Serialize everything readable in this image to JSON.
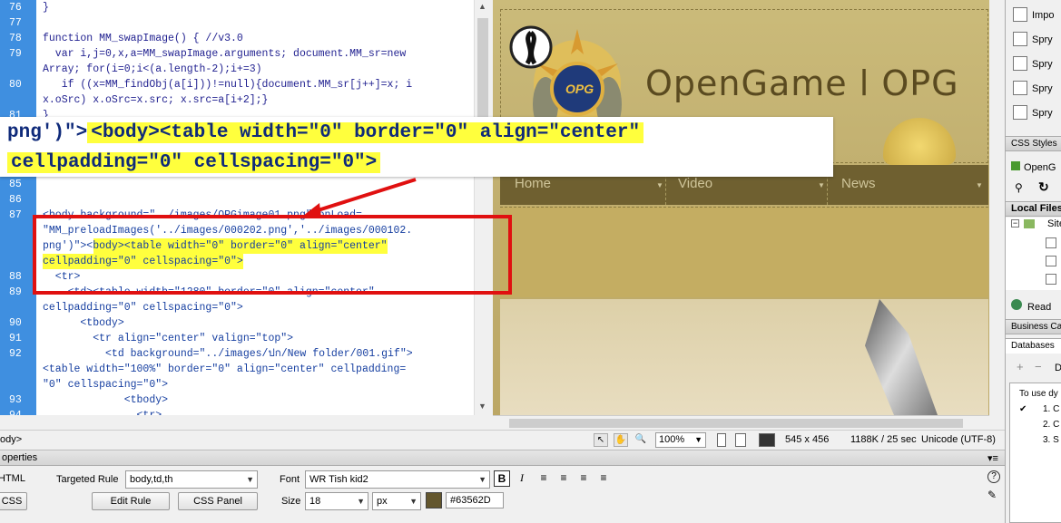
{
  "code": {
    "lines": [
      {
        "num": "76",
        "text": "}"
      },
      {
        "num": "77",
        "text": ""
      },
      {
        "num": "78",
        "text": "function MM_swapImage() { //v3.0"
      },
      {
        "num": "79",
        "text": "  var i,j=0,x,a=MM_swapImage.arguments; document.MM_sr=new"
      },
      {
        "num": "",
        "text": "Array; for(i=0;i<(a.length-2);i+=3)"
      },
      {
        "num": "80",
        "text": "   if ((x=MM_findObj(a[i]))!=null){document.MM_sr[j++]=x; i"
      },
      {
        "num": "",
        "text": "x.oSrc) x.oSrc=x.src; x.src=a[i+2];}"
      },
      {
        "num": "81",
        "text": "}"
      },
      {
        "num": "85",
        "text": ""
      },
      {
        "num": "86",
        "text": ""
      },
      {
        "num": "87",
        "text": "<body background=\"../images/OPGimage01.png\" onLoad="
      },
      {
        "num": "",
        "text": "\"MM_preloadImages('../images/000202.png','../images/000102."
      },
      {
        "num": "",
        "text": "png')\"><body><table width=\"0\" border=\"0\" align=\"center\""
      },
      {
        "num": "",
        "text": "cellpadding=\"0\" cellspacing=\"0\">"
      },
      {
        "num": "88",
        "text": "  <tr>"
      },
      {
        "num": "89",
        "text": "    <td><table width=\"1280\" border=\"0\" align=\"center\""
      },
      {
        "num": "",
        "text": "cellpadding=\"0\" cellspacing=\"0\">"
      },
      {
        "num": "90",
        "text": "      <tbody>"
      },
      {
        "num": "91",
        "text": "        <tr align=\"center\" valign=\"top\">"
      },
      {
        "num": "92",
        "text": "          <td background=\"../images/ปก/New folder/001.gif\">"
      },
      {
        "num": "",
        "text": "<table width=\"100%\" border=\"0\" align=\"center\" cellpadding="
      },
      {
        "num": "",
        "text": "\"0\" cellspacing=\"0\">"
      },
      {
        "num": "93",
        "text": "             <tbody>"
      },
      {
        "num": "94",
        "text": "               <tr>"
      }
    ]
  },
  "callout": {
    "line1_prefix": "png')\">",
    "line1_highlight": "<body><table width=\"0\" border=\"0\" align=\"center\"",
    "line2_highlight": "cellpadding=\"0\" cellspacing=\"0\">"
  },
  "design": {
    "site_title": "OpenGame l OPG",
    "logo_text": "OPG",
    "nav": [
      "Home",
      "Video",
      "News"
    ]
  },
  "status": {
    "tag_fragment": "ody>",
    "zoom": "100%",
    "dimensions": "545 x 456",
    "size_time": "1188K / 25 sec",
    "encoding": "Unicode (UTF-8)"
  },
  "properties": {
    "panel_title": "operties",
    "html_button": "HTML",
    "css_button": "CSS",
    "targeted_rule_label": "Targeted Rule",
    "targeted_rule_value": "body,td,th",
    "edit_rule_button": "Edit Rule",
    "css_panel_button": "CSS Panel",
    "font_label": "Font",
    "font_value": "WR Tish kid2",
    "size_label": "Size",
    "size_value": "18",
    "unit_value": "px",
    "color_hex": "#63562D",
    "bold_label": "B",
    "italic_label": "I",
    "colors": {
      "text_color": "#63562D"
    }
  },
  "right_panel": {
    "insert_items": [
      "Impo",
      "Spry",
      "Spry",
      "Spry",
      "Spry"
    ],
    "css_styles": "CSS Styles",
    "css_styles_item": "OpenG",
    "local_files": "Local Files",
    "site_item": "Site",
    "ready": "Read",
    "business": "Business Cat",
    "databases": "Databases",
    "d_label": "D",
    "help_text": "To use dy",
    "steps": [
      "1. C",
      "2. C",
      "3. S"
    ]
  }
}
